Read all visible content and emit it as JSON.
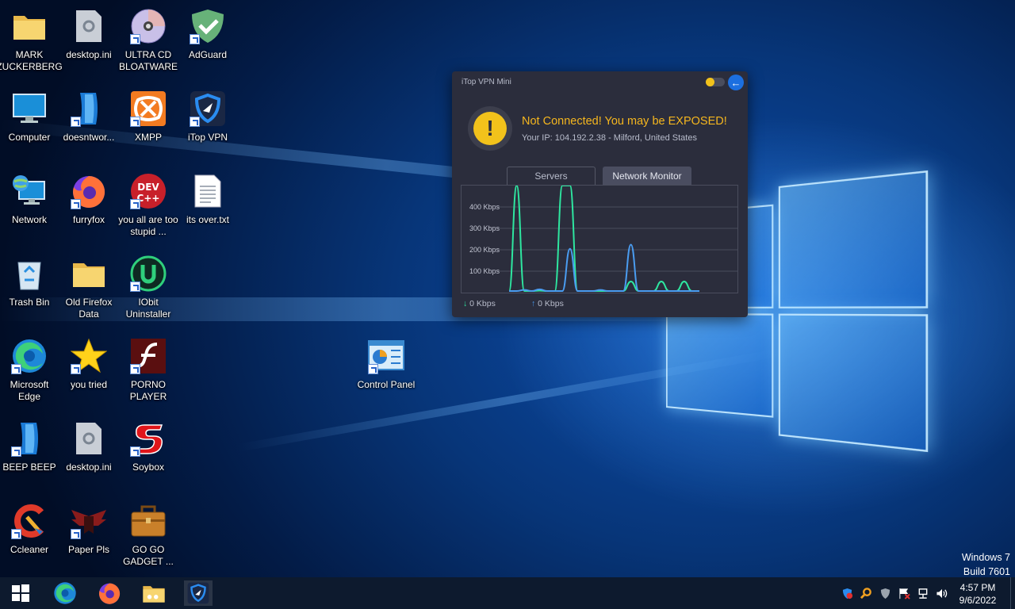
{
  "desktop": {
    "icons": [
      {
        "label": "MARK ZUCKERBERG",
        "icon": "folder-icon"
      },
      {
        "label": "desktop.ini",
        "icon": "settings-file-icon"
      },
      {
        "label": "ULTRA CD BLOATWARE",
        "icon": "cd-icon"
      },
      {
        "label": "AdGuard",
        "icon": "shield-check-icon"
      },
      {
        "label": "Computer",
        "icon": "monitor-icon"
      },
      {
        "label": "doesntwor...",
        "icon": "app-icon"
      },
      {
        "label": "XMPP",
        "icon": "xampp-icon"
      },
      {
        "label": "iTop VPN",
        "icon": "vpn-shield-icon"
      },
      {
        "label": "Network",
        "icon": "network-globe-icon"
      },
      {
        "label": "furryfox",
        "icon": "firefox-icon"
      },
      {
        "label": "you all are too stupid ...",
        "icon": "dev-cpp-icon"
      },
      {
        "label": "its over.txt",
        "icon": "text-file-icon"
      },
      {
        "label": "Trash Bin",
        "icon": "recycle-bin-icon"
      },
      {
        "label": "Old Firefox Data",
        "icon": "folder-icon"
      },
      {
        "label": "IObit Uninstaller",
        "icon": "uninstaller-icon"
      },
      {
        "label": "Microsoft Edge",
        "icon": "edge-icon"
      },
      {
        "label": "you tried",
        "icon": "star-icon"
      },
      {
        "label": "PORNO PLAYER",
        "icon": "flash-player-icon"
      },
      {
        "label": "BEEP BEEP",
        "icon": "app-icon"
      },
      {
        "label": "desktop.ini",
        "icon": "settings-file-icon"
      },
      {
        "label": "Soybox",
        "icon": "s-logo-icon"
      },
      {
        "label": "Ccleaner",
        "icon": "ccleaner-icon"
      },
      {
        "label": "Paper Pls",
        "icon": "eagle-emblem-icon"
      },
      {
        "label": "GO GO GADGET ...",
        "icon": "briefcase-icon"
      },
      {
        "label": "Control Panel",
        "icon": "control-panel-icon"
      }
    ]
  },
  "vpn": {
    "title": "iTop VPN Mini",
    "status": "Not Connected! You may be EXPOSED!",
    "ip_line": "Your IP: 104.192.2.38 - Milford, United States",
    "tabs": {
      "servers": "Servers",
      "monitor": "Network Monitor"
    },
    "chart_labels": [
      "400 Kbps",
      "300 Kbps",
      "200 Kbps",
      "100 Kbps"
    ],
    "download": "0 Kbps",
    "upload": "0 Kbps",
    "colors": {
      "accent": "#f2c21b",
      "status": "#f5b61e",
      "download_line": "#2ee6a0",
      "upload_line": "#4a9cf0"
    }
  },
  "chart_data": {
    "type": "line",
    "ylabel": "",
    "ylim": [
      0,
      500
    ],
    "y_ticks": [
      "400 Kbps",
      "300 Kbps",
      "200 Kbps",
      "100 Kbps"
    ],
    "series": [
      {
        "color": "#2ee6a0",
        "values": [
          0,
          500,
          0,
          0,
          2,
          0,
          0,
          500,
          500,
          0,
          0,
          0,
          0,
          0,
          0,
          0,
          45,
          0,
          0,
          0,
          45,
          0,
          0,
          45,
          0,
          0
        ]
      },
      {
        "color": "#4a9cf0",
        "values": [
          0,
          0,
          5,
          0,
          8,
          0,
          0,
          0,
          200,
          0,
          0,
          0,
          5,
          0,
          0,
          0,
          220,
          0,
          0,
          0,
          0,
          0,
          0,
          0,
          0,
          0
        ]
      }
    ]
  },
  "taskbar": {
    "apps": [
      "windows-start-icon",
      "edge-icon",
      "firefox-icon",
      "file-explorer-icon",
      "itop-vpn-icon"
    ],
    "time": "4:57 PM",
    "date": "9/6/2022"
  },
  "watermark": {
    "line1": "Windows 7",
    "line2": "Build 7601"
  }
}
